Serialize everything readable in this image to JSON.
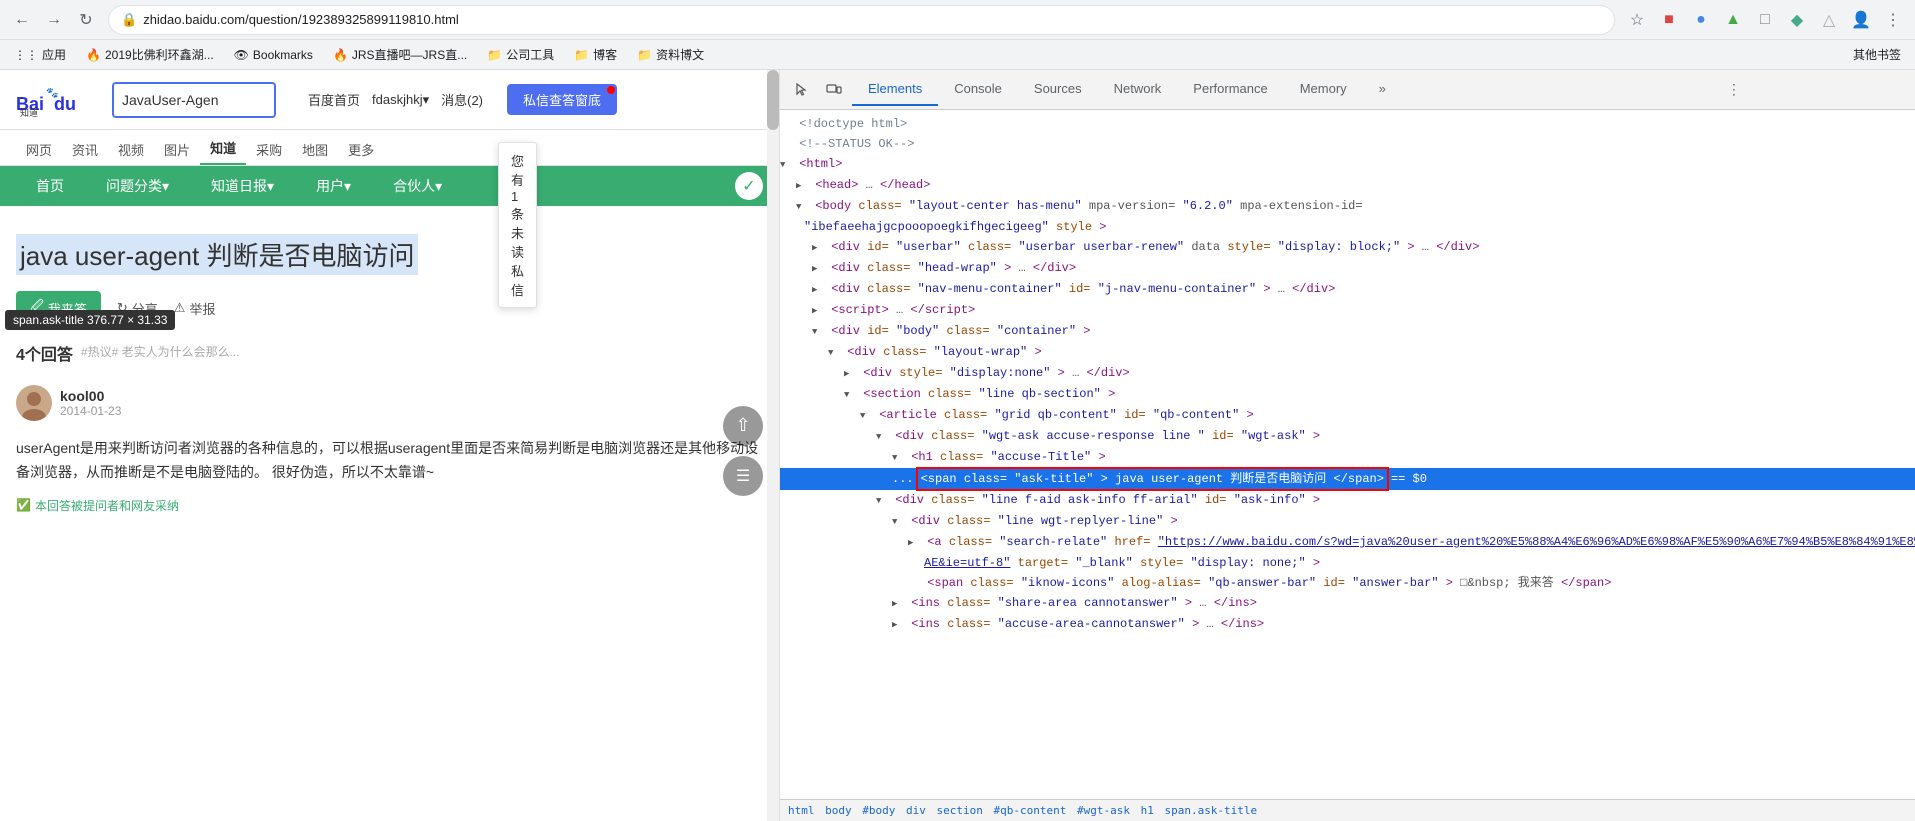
{
  "browser": {
    "url": "zhidao.baidu.com/question/192389325899119810.html",
    "back_disabled": false,
    "forward_disabled": false,
    "bookmarks": [
      {
        "label": "应用",
        "icon": "grid"
      },
      {
        "label": "2019比佛利环鑫湖...",
        "icon": "bookmark"
      },
      {
        "label": "Bookmarks",
        "icon": "bookmark"
      },
      {
        "label": "JRS直播吧—JRS直...",
        "icon": "bookmark"
      },
      {
        "label": "公司工具",
        "icon": "folder"
      },
      {
        "label": "博客",
        "icon": "folder"
      },
      {
        "label": "资料博文",
        "icon": "folder"
      },
      {
        "label": "其他书签",
        "icon": "folder"
      }
    ]
  },
  "page": {
    "search_value": "JavaUser-Agen",
    "nav_links": [
      "百度首页",
      "fdaskjhkj▾",
      "消息(2)",
      "私信查答窗底"
    ],
    "notification_text": "您有1条未读私信",
    "tabs": [
      "网页",
      "资讯",
      "视频",
      "图片",
      "知道",
      "采购",
      "地图",
      "更多"
    ],
    "active_tab": "知道",
    "nav_items": [
      "首页",
      "问题分类▾",
      "知道日报▾",
      "用户▾",
      "合伙人▾"
    ],
    "tooltip": "span.ask-title  376.77 × 31.33",
    "question_title": "java user-agent 判断是否电脑访问",
    "answers_count": "4个回答",
    "hot_tag": "#热议# 老实人为什么会那么...",
    "answer_user": "kool00",
    "answer_date": "2014-01-23",
    "answer_text": "userAgent是用来判断访问者浏览器的各种信息的，可以根据useragent里面是否来简易判断是电脑浏览器还是其他移动设备浏览器，从而推断是不是电脑登陆的。\n很好伪造，所以不太靠谱~",
    "verified_text": "本回答被提问者和网友采纳",
    "action_buttons": {
      "answer": "我来答",
      "share": "分享",
      "report": "举报"
    }
  },
  "devtools": {
    "tabs": [
      "Elements",
      "Console",
      "Sources",
      "Network",
      "Performance",
      "Memory",
      "»"
    ],
    "active_tab": "Elements",
    "html_lines": [
      {
        "indent": 0,
        "text": "<!doctype html>",
        "type": "comment"
      },
      {
        "indent": 0,
        "text": "<!--STATUS OK-->",
        "type": "comment"
      },
      {
        "indent": 0,
        "tag": "html",
        "open": true,
        "triangle": "open"
      },
      {
        "indent": 1,
        "tag": "head",
        "collapsed": true,
        "triangle": "closed",
        "text": "<head>…</head>"
      },
      {
        "indent": 1,
        "tag": "body",
        "attrs": "class=\"layout-center has-menu\" mpa-version=\"6.2.0\" mpa-extension-id=\n\"ibefaeehajgcpooopoegkifhgecigeeg\" style>",
        "open": true,
        "triangle": "open"
      },
      {
        "indent": 2,
        "tag": "div",
        "attrs": "id=\"userbar\" class=\"userbar userbar-renew\" data style=\"display: block;\"",
        "collapsed": true,
        "triangle": "closed"
      },
      {
        "indent": 2,
        "tag": "div",
        "attrs": "class=\"head-wrap\"",
        "collapsed": true,
        "triangle": "closed"
      },
      {
        "indent": 2,
        "tag": "div",
        "attrs": "class=\"nav-menu-container\" id=\"j-nav-menu-container\"",
        "collapsed": true,
        "triangle": "closed"
      },
      {
        "indent": 2,
        "tag": "script",
        "collapsed": true,
        "triangle": "closed"
      },
      {
        "indent": 2,
        "tag": "div",
        "attrs": "id=\"body\" class=\"container\"",
        "open": true,
        "triangle": "open"
      },
      {
        "indent": 3,
        "tag": "div",
        "attrs": "class=\"layout-wrap\"",
        "open": true,
        "triangle": "open"
      },
      {
        "indent": 4,
        "tag": "div",
        "attrs": "style=\"display:none\"",
        "collapsed": true,
        "triangle": "closed"
      },
      {
        "indent": 4,
        "tag": "section",
        "attrs": "class=\"line qb-section\"",
        "open": true,
        "triangle": "open"
      },
      {
        "indent": 5,
        "tag": "article",
        "attrs": "class=\"grid qb-content\" id=\"qb-content\"",
        "open": true,
        "triangle": "open"
      },
      {
        "indent": 6,
        "tag": "div",
        "attrs": "class=\"wgt-ask accuse-response line \" id=\"wgt-ask\"",
        "open": true,
        "triangle": "open"
      },
      {
        "indent": 7,
        "tag": "h1",
        "attrs": "class=\"accuse-Title\"",
        "open": true,
        "triangle": "open"
      },
      {
        "indent": 7,
        "selected": true,
        "text": "<span class=\"ask-title\">java user-agent 判断是否电脑访问</span> == $0"
      },
      {
        "indent": 6,
        "tag": "div",
        "attrs": "class=\"line f-aid ask-info ff-arial\" id=\"ask-info\"",
        "open": true,
        "triangle": "open"
      },
      {
        "indent": 7,
        "tag": "div",
        "attrs": "class=\"line wgt-replyer-line\"",
        "open": true,
        "triangle": "open"
      },
      {
        "indent": 8,
        "tag": "a",
        "attrs": "class=\"search-relate\" href=\"https://www.baidu.com/s?wd=java%20user-agent%20%E5%88%A4%E6%96%AD%E6%98%AF%E5%90%A6%E7%94%B5%E8%84%91%E8%AE%BF%E9%97%AE&ie=utf-8\" target=\"_blank\" style=\"display: none;\"",
        "collapsed": true,
        "triangle": "closed"
      },
      {
        "indent": 8,
        "tag": "span",
        "attrs": "class=\"iknow-icons\" alog-alias=\"qb-answer-bar\" id=\"answer-bar\"",
        "text": "□&nbsp;\n我来答"
      },
      {
        "indent": 7,
        "tag": "ins",
        "attrs": "class=\"share-area cannotanswer\"",
        "collapsed": true,
        "triangle": "closed"
      },
      {
        "indent": 7,
        "tag": "ins",
        "attrs": "class=\"accuse-area-cannotanswer\"",
        "collapsed": true,
        "triangle": "closed"
      }
    ],
    "breadcrumb": [
      "html",
      "body",
      "#body",
      "div",
      "section",
      "#qb-content",
      "#wgt-ask",
      "h1",
      "span.ask-title"
    ]
  }
}
